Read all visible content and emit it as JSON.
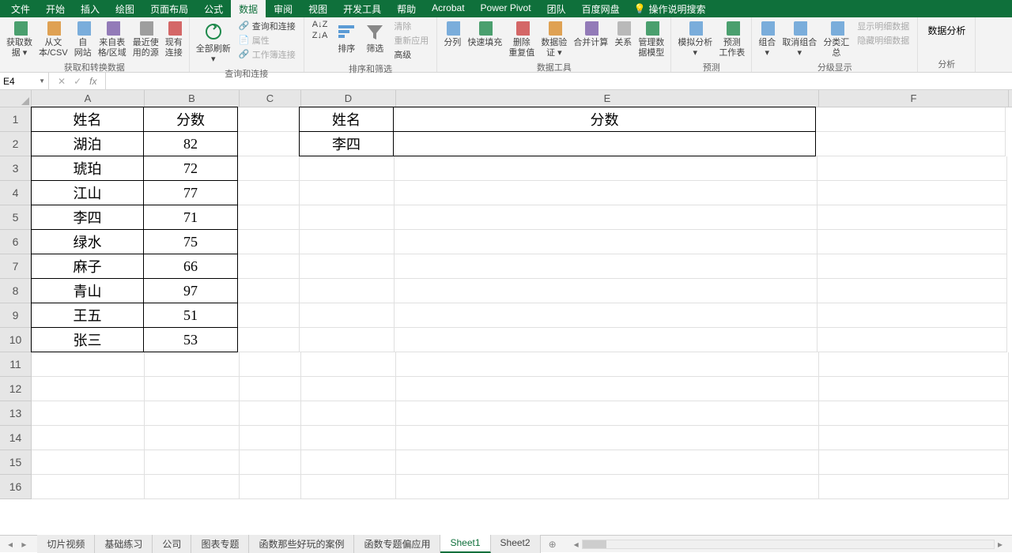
{
  "menu": {
    "tabs": [
      "文件",
      "开始",
      "插入",
      "绘图",
      "页面布局",
      "公式",
      "数据",
      "审阅",
      "视图",
      "开发工具",
      "帮助",
      "Acrobat",
      "Power Pivot",
      "团队",
      "百度网盘"
    ],
    "active_index": 6,
    "tell_me": "操作说明搜索"
  },
  "ribbon": {
    "groups": [
      {
        "label": "获取和转换数据",
        "items": [
          "获取数\n据 ▾",
          "从文\n本/CSV",
          "自\n网站",
          "来自表\n格/区域",
          "最近使\n用的源",
          "现有\n连接"
        ]
      },
      {
        "label": "查询和连接",
        "items_large": [
          "全部刷新\n▾"
        ],
        "items_small": [
          "查询和连接",
          "属性",
          "工作簿连接"
        ]
      },
      {
        "label": "排序和筛选",
        "items_large": [
          "排序",
          "筛选"
        ],
        "items_small": [
          "清除",
          "重新应用",
          "高级"
        ],
        "sort_icons": [
          "A↓Z",
          "Z↓A"
        ]
      },
      {
        "label": "数据工具",
        "items": [
          "分列",
          "快速填充",
          "删除\n重复值",
          "数据验\n证 ▾",
          "合并计算",
          "关系",
          "管理数\n据模型"
        ]
      },
      {
        "label": "预测",
        "items": [
          "模拟分析\n▾",
          "预测\n工作表"
        ]
      },
      {
        "label": "分级显示",
        "items": [
          "组合\n▾",
          "取消组合\n▾",
          "分类汇\n总"
        ],
        "items_small": [
          "显示明细数据",
          "隐藏明细数据"
        ]
      },
      {
        "label": "分析",
        "items": [
          "数据分析"
        ]
      }
    ]
  },
  "name_box": "E4",
  "formula": "",
  "columns": [
    "A",
    "B",
    "C",
    "D",
    "E",
    "F"
  ],
  "rows": [
    "1",
    "2",
    "3",
    "4",
    "5",
    "6",
    "7",
    "8",
    "9",
    "10",
    "11",
    "12",
    "13",
    "14",
    "15",
    "16"
  ],
  "data": {
    "A1": "姓名",
    "B1": "分数",
    "D1": "姓名",
    "E1": "分数",
    "A2": "湖泊",
    "B2": "82",
    "D2": "李四",
    "E2": "",
    "A3": "琥珀",
    "B3": "72",
    "A4": "江山",
    "B4": "77",
    "A5": "李四",
    "B5": "71",
    "A6": "绿水",
    "B6": "75",
    "A7": "麻子",
    "B7": "66",
    "A8": "青山",
    "B8": "97",
    "A9": "王五",
    "B9": "51",
    "A10": "张三",
    "B10": "53"
  },
  "borders": [
    "A1",
    "B1",
    "A2",
    "B2",
    "A3",
    "B3",
    "A4",
    "B4",
    "A5",
    "B5",
    "A6",
    "B6",
    "A7",
    "B7",
    "A8",
    "B8",
    "A9",
    "B9",
    "A10",
    "B10",
    "D1",
    "E1",
    "D2",
    "E2"
  ],
  "sheets": {
    "tabs": [
      "切片视频",
      "基础练习",
      "公司",
      "图表专题",
      "函数那些好玩的案例",
      "函数专题偏应用",
      "Sheet1",
      "Sheet2"
    ],
    "active_index": 6
  }
}
